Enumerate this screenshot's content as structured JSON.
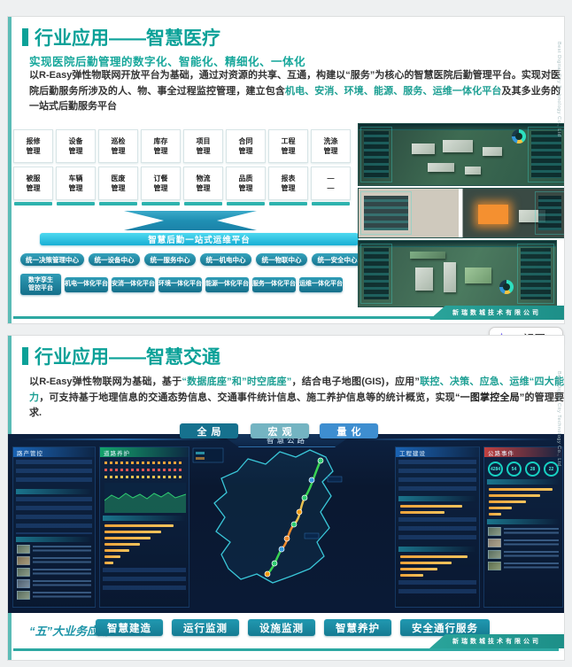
{
  "page": {
    "company_footer": "新瑞数城技术有限公司",
    "side_watermark": "Best Digital City Technology Co., Ltd"
  },
  "ai_button": {
    "label": "AI识图",
    "chevron": "▾"
  },
  "slide1": {
    "title": "行业应用——智慧医疗",
    "subtitle": "实现医院后勤管理的数字化、智能化、精细化、一体化",
    "para": {
      "p1": "以R-Easy弹性物联网开放平台为基础，通过对资源的共享、互通，构建以“服务”为核心的智慧医院后勤管理平台。实现对医院后勤服务所涉及的人、物、事全过程监控管理，建立包含",
      "hl": "机电、安消、环境、能源、服务、运维一体化平台",
      "p2": "及其多业务的一站式后勤服务平台"
    },
    "modules_row1": [
      "报修\n管理",
      "设备\n管理",
      "巡检\n管理",
      "库存\n管理",
      "项目\n管理",
      "合同\n管理",
      "工程\n管理",
      "洗涤\n管理"
    ],
    "modules_row2": [
      "被服\n管理",
      "车辆\n管理",
      "医废\n管理",
      "订餐\n管理",
      "物流\n管理",
      "品质\n管理",
      "报表\n管理",
      "—\n—"
    ],
    "banner": "智慧后勤一站式运维平台",
    "centers": [
      "统一决策管理中心",
      "统一设备中心",
      "统一服务中心",
      "统一机电中心",
      "统一物联中心",
      "统一安全中心"
    ],
    "platforms": [
      "数字孪生\n管控平台",
      "机电一体化平台",
      "安消一体化平台",
      "环境一体化平台",
      "能源一体化平台",
      "服务一体化平台",
      "运维一体化平台"
    ]
  },
  "slide2": {
    "title": "行业应用——智慧交通",
    "para": {
      "p1": "以R-Easy弹性物联网为基础，基于",
      "h1": "“数据底座”和”时空底座”",
      "p2": "，结合电子地图(GIS)，应用”",
      "h2": "联控、决策、应急、运维“四大能力",
      "p3": "，可支持基于地理信息的交通态势信息、交通事件统计信息、施工养护信息等的统计概览，实现",
      "h3": "“一图掌控全局”",
      "p4": "的管理要求."
    },
    "mode_buttons": [
      "全局",
      "宏观",
      "量化"
    ],
    "dashboard": {
      "title": "智慧公路",
      "panel_road_assets": "路产管控",
      "panel_maintenance": "道路养护",
      "panel_construction": "工程建设",
      "panel_events": "公路事件",
      "gauges": [
        "4284",
        "54",
        "28",
        "22"
      ]
    },
    "biz_label": "“五”大业务应用",
    "biz_buttons": [
      "智慧建造",
      "运行监测",
      "设施监测",
      "智慧养护",
      "安全通行服务"
    ]
  }
}
